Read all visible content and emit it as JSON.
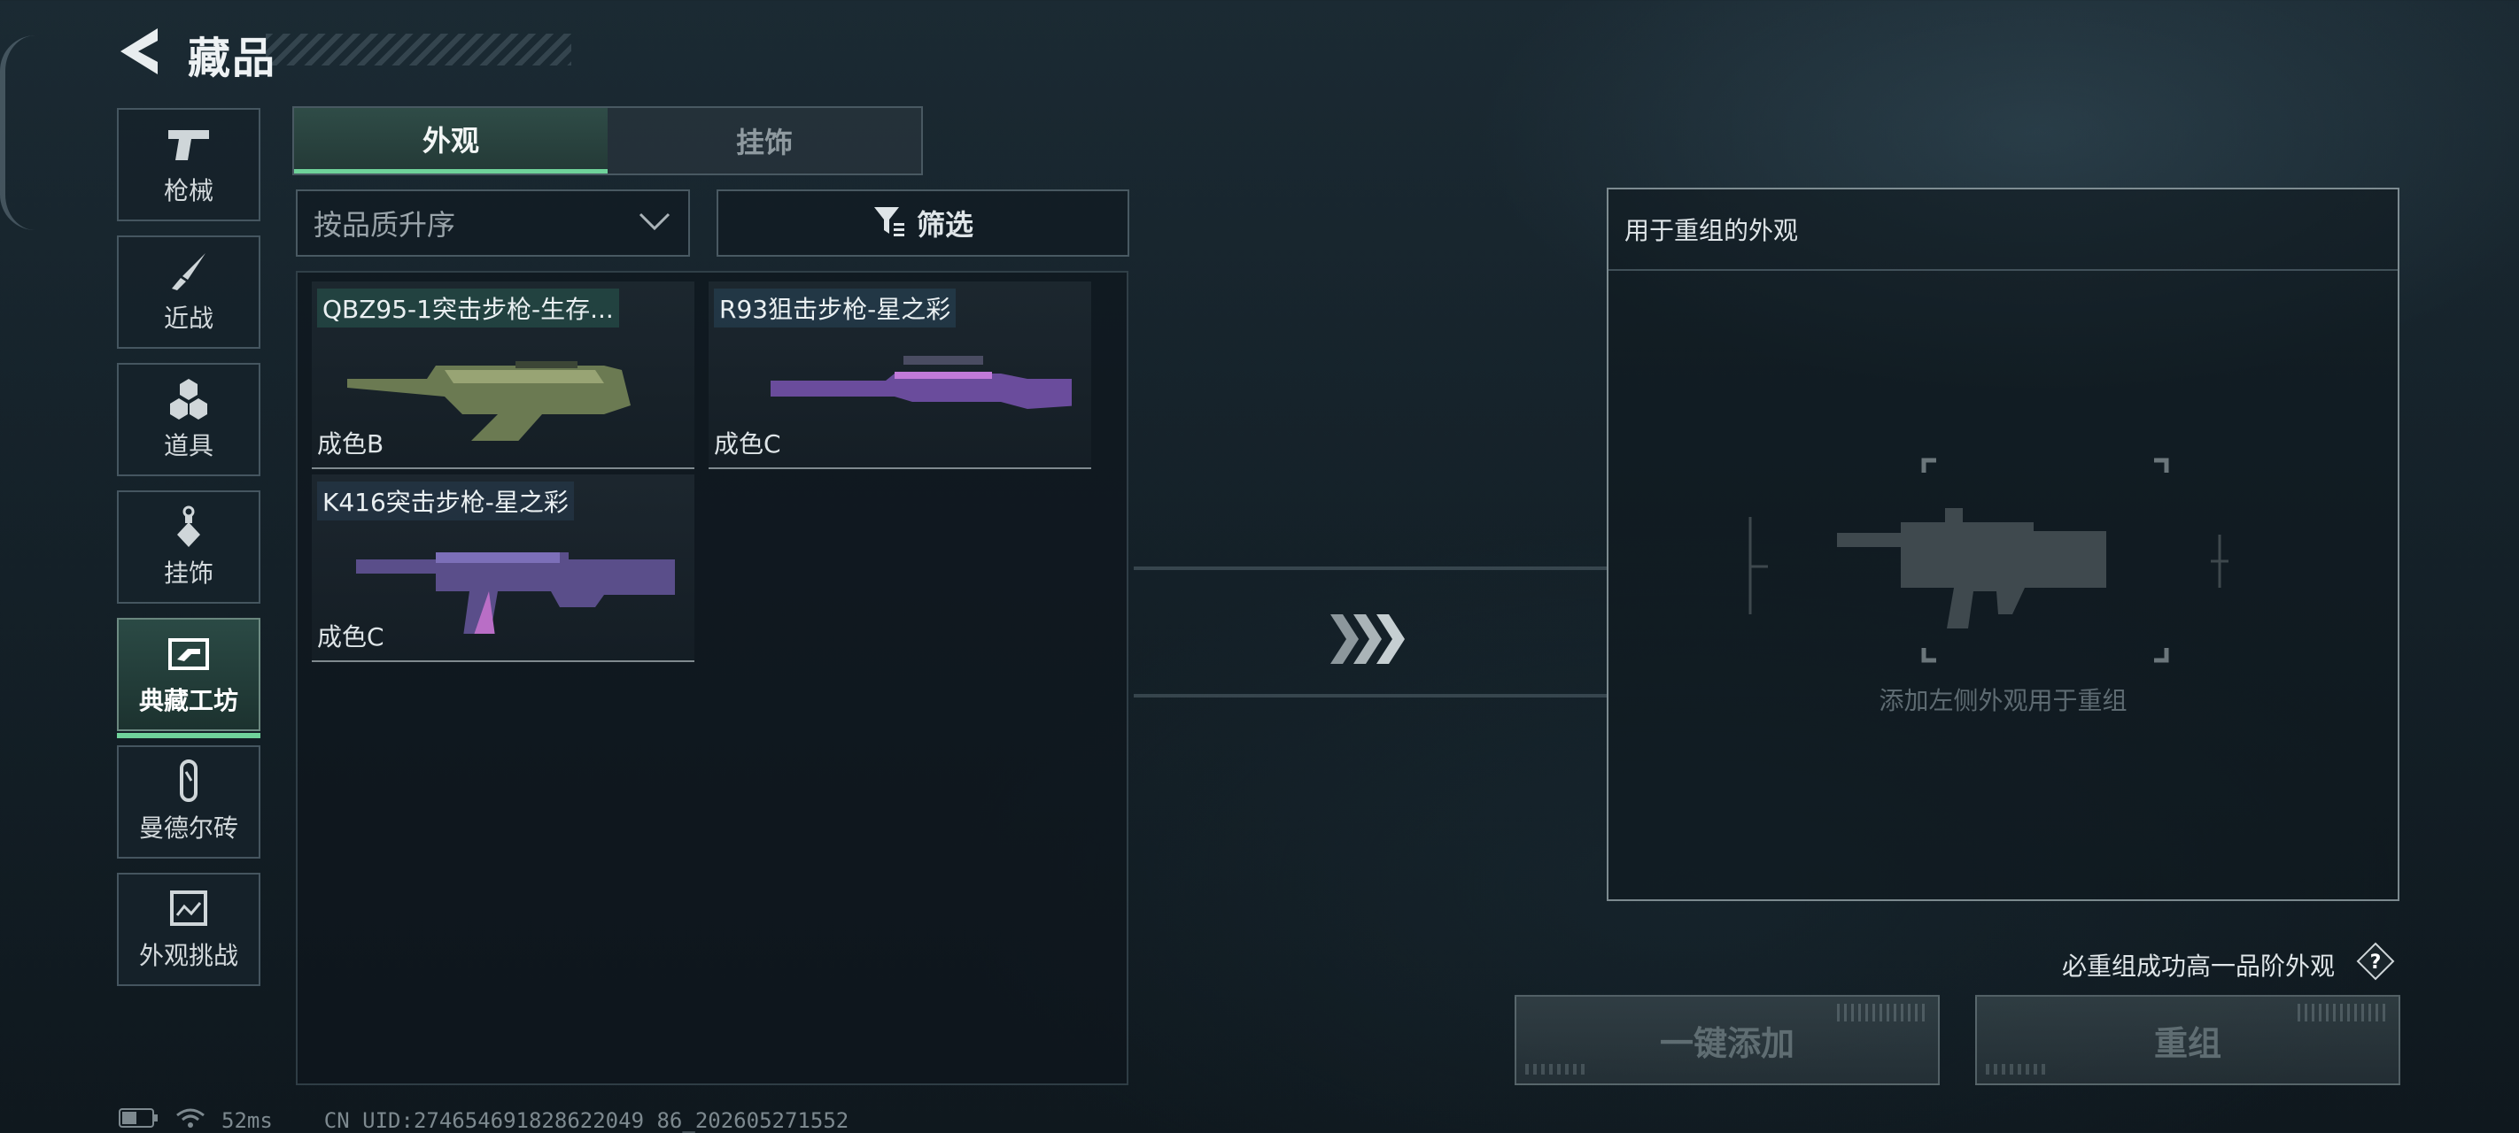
{
  "header": {
    "title": "藏品"
  },
  "categories": [
    {
      "label": "枪械",
      "icon": "pistol-icon"
    },
    {
      "label": "近战",
      "icon": "knife-icon"
    },
    {
      "label": "道具",
      "icon": "grenades-icon"
    },
    {
      "label": "挂饰",
      "icon": "charm-icon"
    },
    {
      "label": "典藏工坊",
      "icon": "workshop-icon",
      "active": true
    },
    {
      "label": "曼德尔砖",
      "icon": "brick-icon"
    },
    {
      "label": "外观挑战",
      "icon": "challenge-icon"
    }
  ],
  "tabs": [
    {
      "label": "外观",
      "active": true
    },
    {
      "label": "挂饰",
      "active": false
    }
  ],
  "sort": {
    "value": "按品质升序"
  },
  "filter": {
    "label": "筛选"
  },
  "items": [
    {
      "name": "QBZ95-1突击步枪-生存...",
      "grade": "成色B"
    },
    {
      "name": "R93狙击步枪-星之彩",
      "grade": "成色C"
    },
    {
      "name": "K416突击步枪-星之彩",
      "grade": "成色C"
    }
  ],
  "recombine": {
    "header": "用于重组的外观",
    "placeholder": "添加左侧外观用于重组",
    "guarantee": "必重组成功高一品阶外观",
    "add_button": "一键添加",
    "recombine_button": "重组"
  },
  "status": {
    "ping": "52ms",
    "uid": "CN UID:274654691828622049 86_202605271552"
  },
  "colors": {
    "accent": "#6fd29a",
    "background": "#16232b"
  }
}
